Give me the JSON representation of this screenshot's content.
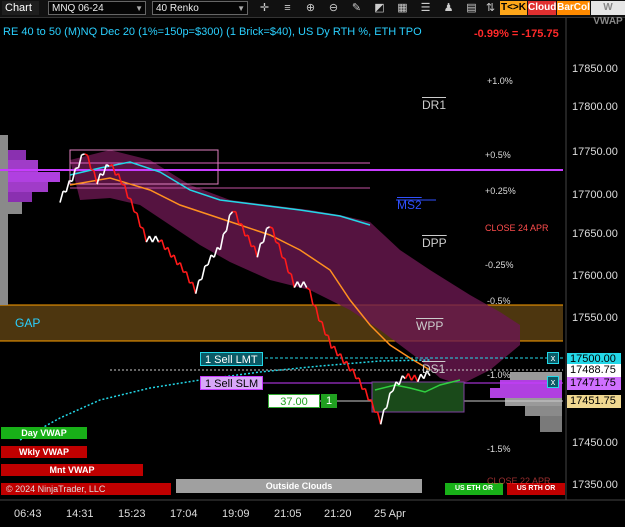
{
  "toolbar": {
    "chart_label": "Chart",
    "instrument": "MNQ 06-24",
    "bar_type": "40 Renko",
    "buttons": {
      "tk": "T<>K",
      "cloud": "Cloud",
      "barcol": "BarCol",
      "vwaps": "W VWAP"
    },
    "icons": [
      "crosshair-icon",
      "bars-icon",
      "magnify-plus-icon",
      "magnify-minus-icon",
      "pencil-icon",
      "drawing-tools-icon",
      "template-icon",
      "properties-icon",
      "strategy-icon",
      "data-box-icon",
      "chart-trader-icon"
    ]
  },
  "header": {
    "title": "RE 40 to 50 (M)NQ Dec 20 (1%=150p=$300) (1 Brick=$40), US Dy RTH %, ETH TPO",
    "change": "-0.99% = -175.75"
  },
  "percent_levels": [
    "+1.0%",
    "+0.5%",
    "+0.25%",
    "CLOSE 24 APR",
    "-0.25%",
    "-0.5%",
    "-1.0%",
    "-1.5%"
  ],
  "markers": {
    "dr1": "DR1",
    "ms2": "MS2",
    "dpp": "DPP",
    "wpp": "WPP",
    "ds1": "DS1",
    "gap": "GAP"
  },
  "y_axis": {
    "ticks": [
      "17850.00",
      "17800.00",
      "17750.00",
      "17700.00",
      "17650.00",
      "17600.00",
      "17550.00",
      "17500.00",
      "17450.00",
      "17400.00",
      "17350.00"
    ],
    "price_boxes": [
      "17500.00",
      "17488.75",
      "17471.75",
      "17451.75"
    ]
  },
  "x_axis": {
    "ticks": [
      "06:43",
      "14:31",
      "15:23",
      "17:04",
      "19:09",
      "21:05",
      "21:20",
      "25 Apr"
    ]
  },
  "orders": {
    "sell_lmt": "1 Sell LMT",
    "sell_slm": "1 Sell SLM",
    "position_price": "37.00",
    "position_qty": "1",
    "cancel_icon": "x"
  },
  "legend": {
    "day_vwap": "Day VWAP",
    "wkly_vwap": "Wkly VWAP",
    "mnt_vwap": "Mnt VWAP",
    "copyright": "© 2024 NinjaTrader, LLC",
    "outside_clouds": "Outside Clouds",
    "us_eth_or": "US ETH OR",
    "us_rth_or": "US RTH OR",
    "close_label": "CLOSE 22 APR"
  },
  "colors": {
    "title": "#2ad0ff",
    "up_brick": "#ffffff",
    "down_brick": "#ff1a1a",
    "cloud": "#6a1850",
    "gap_zone": "#5a4012",
    "magenta": "#c83cff",
    "cyan": "#23d8e8"
  },
  "chart_data": {
    "type": "renko",
    "ylim": [
      17340,
      17880
    ],
    "bricks": [
      17712,
      17740,
      17776,
      17736,
      17760,
      17736,
      17700,
      17660,
      17660,
      17640,
      17620,
      17592,
      17630,
      17650,
      17700,
      17668,
      17640,
      17680,
      17640,
      17600,
      17600,
      17556,
      17520,
      17500,
      17480,
      17452,
      17420,
      17464,
      17480,
      17476,
      17484
    ]
  }
}
